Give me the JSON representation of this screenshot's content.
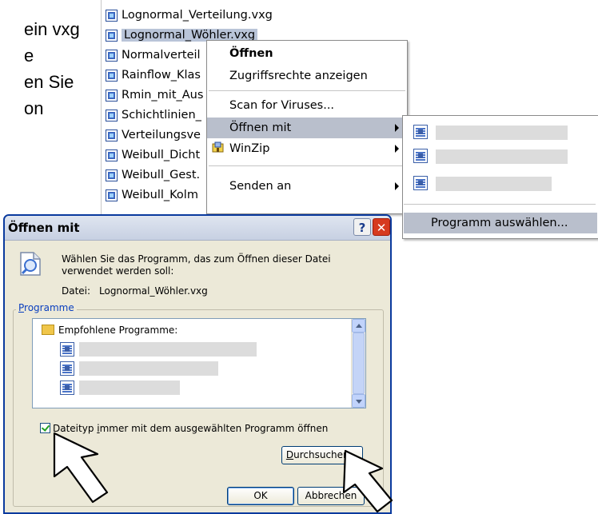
{
  "doc_text": {
    "lines": [
      "ein vxg",
      "e",
      "en Sie",
      "on"
    ]
  },
  "explorer": {
    "files": [
      {
        "name": "Lognormal_Verteilung.vxg",
        "selected": false
      },
      {
        "name": "Lognormal_Wöhler.vxg",
        "selected": true
      },
      {
        "name": "Normalverteil",
        "selected": false
      },
      {
        "name": "Rainflow_Klas",
        "selected": false
      },
      {
        "name": "Rmin_mit_Aus",
        "selected": false
      },
      {
        "name": "Schichtlinien_",
        "selected": false
      },
      {
        "name": "Verteilungsve",
        "selected": false
      },
      {
        "name": "Weibull_Dicht",
        "selected": false
      },
      {
        "name": "Weibull_Gest.",
        "selected": false
      },
      {
        "name": "Weibull_Kolm",
        "selected": false
      }
    ]
  },
  "context_menu": {
    "open": "Öffnen",
    "access_rights": "Zugriffsrechte anzeigen",
    "scan": "Scan for Viruses...",
    "open_with": "Öffnen mit",
    "winzip": "WinZip",
    "send_to": "Senden an"
  },
  "submenu": {
    "choose_program": "Programm auswählen..."
  },
  "dialog": {
    "title": "Öffnen mit",
    "help_glyph": "?",
    "close_glyph": "✕",
    "description": "Wählen Sie das Programm, das zum Öffnen dieser Datei verwendet werden soll:",
    "file_label": "Datei:",
    "file_name": "Lognormal_Wöhler.vxg",
    "programs_group_accesskey": "P",
    "programs_group_rest": "rogramme",
    "recommended_programs": "Empfohlene Programme:",
    "always_open_prefix": "Dateityp ",
    "always_open_accesskey": "i",
    "always_open_rest": "mmer mit dem ausgewählten Programm öffnen",
    "always_open_checked": true,
    "browse_accesskey": "D",
    "browse_rest": "urchsuchen...",
    "ok": "OK",
    "cancel": "Abbrechen"
  },
  "colors": {
    "menu_highlight": "#b9bfcc",
    "dialog_bg": "#ece9d8",
    "dialog_border": "#0a3a9e",
    "close_button": "#d63a1f"
  },
  "icons": [
    "vxg-file-icon",
    "winzip-icon",
    "program-icon",
    "info-icon",
    "folder-icon",
    "arrow-cursor-icon"
  ]
}
